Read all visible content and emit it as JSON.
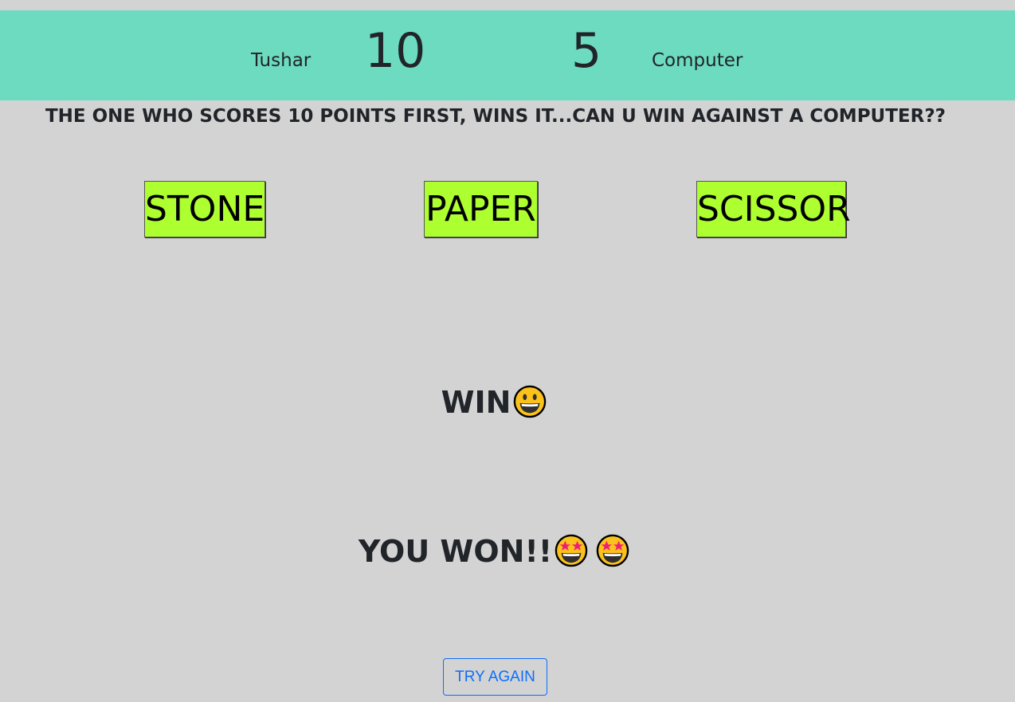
{
  "scoreboard": {
    "player_name": "Tushar",
    "player_score": "10",
    "computer_score": "5",
    "computer_name": "Computer",
    "bar_color": "#6ddbc0"
  },
  "rules_text": "THE ONE WHO SCORES 10 POINTS FIRST, WINS IT...CAN U WIN AGAINST A COMPUTER??",
  "choices": {
    "stone": "STONE",
    "paper": "PAPER",
    "scissor": "SCISSOR",
    "button_color": "#adff2f"
  },
  "round_result": {
    "text": "WIN",
    "emoji": "grinning-face-icon"
  },
  "game_result": {
    "text": "YOU WON!!",
    "emojis": [
      "star-struck-icon",
      "star-struck-icon"
    ]
  },
  "try_again_label": "TRY AGAIN",
  "colors": {
    "background": "#d3d3d3",
    "try_again": "#0d6efd"
  }
}
